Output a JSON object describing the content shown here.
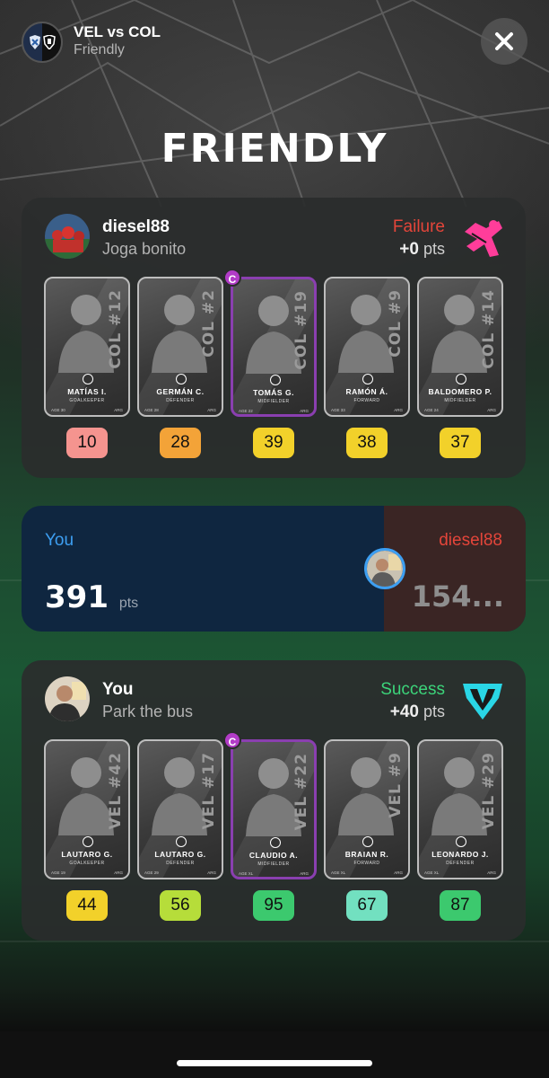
{
  "header": {
    "match_title": "VEL vs COL",
    "match_subtitle": "Friendly",
    "close_icon": "close-icon"
  },
  "page_title": "FRIENDLY",
  "opponent": {
    "name": "diesel88",
    "strategy": "Joga bonito",
    "result": "Failure",
    "result_color": "#e4453a",
    "points": "+0",
    "points_unit": "pts",
    "strategy_icon": "pink-player-icon",
    "cards": [
      {
        "number": "COL #12",
        "name": "MATÍAS I.",
        "position": "GOALKEEPER",
        "age": "AGE 30",
        "team": "ARG",
        "captain": false
      },
      {
        "number": "COL #2",
        "name": "GERMÁN C.",
        "position": "DEFENDER",
        "age": "AGE 28",
        "team": "ARG",
        "captain": false
      },
      {
        "number": "COL #19",
        "name": "TOMÁS G.",
        "position": "MIDFIELDER",
        "age": "AGE 22",
        "team": "ARG",
        "captain": true
      },
      {
        "number": "COL #9",
        "name": "RAMÓN Á.",
        "position": "FORWARD",
        "age": "AGE 33",
        "team": "ARG",
        "captain": false
      },
      {
        "number": "COL #14",
        "name": "BALDOMERO P.",
        "position": "MIDFIELDER",
        "age": "AGE 24",
        "team": "ARG",
        "captain": false
      }
    ],
    "scores": [
      {
        "value": "10",
        "color": "#f5948f"
      },
      {
        "value": "28",
        "color": "#f3a338"
      },
      {
        "value": "39",
        "color": "#f2d12a"
      },
      {
        "value": "38",
        "color": "#f2d12a"
      },
      {
        "value": "37",
        "color": "#f2d12a"
      }
    ]
  },
  "versus": {
    "you_label": "You",
    "you_points": "391",
    "you_unit": "pts",
    "opp_label": "diesel88",
    "opp_points": "154..."
  },
  "me": {
    "name": "You",
    "strategy": "Park the bus",
    "result": "Success",
    "result_color": "#3cd47a",
    "points": "+40",
    "points_unit": "pts",
    "strategy_icon": "cyan-shield-icon",
    "cards": [
      {
        "number": "VEL #42",
        "name": "LAUTARO G.",
        "position": "GOALKEEPER",
        "age": "AGE 19",
        "team": "ARG",
        "captain": false
      },
      {
        "number": "VEL #17",
        "name": "LAUTARO G.",
        "position": "DEFENDER",
        "age": "AGE 29",
        "team": "ARG",
        "captain": false
      },
      {
        "number": "VEL #22",
        "name": "CLAUDIO A.",
        "position": "MIDFIELDER",
        "age": "AGE XL",
        "team": "ARG",
        "captain": true
      },
      {
        "number": "VEL #9",
        "name": "BRAIAN R.",
        "position": "FORWARD",
        "age": "AGE XL",
        "team": "ARG",
        "captain": false
      },
      {
        "number": "VEL #29",
        "name": "LEONARDO J.",
        "position": "DEFENDER",
        "age": "AGE XL",
        "team": "ARG",
        "captain": false
      }
    ],
    "scores": [
      {
        "value": "44",
        "color": "#f2d12a"
      },
      {
        "value": "56",
        "color": "#b6dd3a"
      },
      {
        "value": "95",
        "color": "#3cc96e"
      },
      {
        "value": "67",
        "color": "#72e0c0"
      },
      {
        "value": "87",
        "color": "#3cc96e"
      }
    ]
  },
  "captain_label": "C",
  "colors": {
    "you": "#3d9ff2",
    "opponent": "#e4453a",
    "captain": "#b23cc7"
  }
}
